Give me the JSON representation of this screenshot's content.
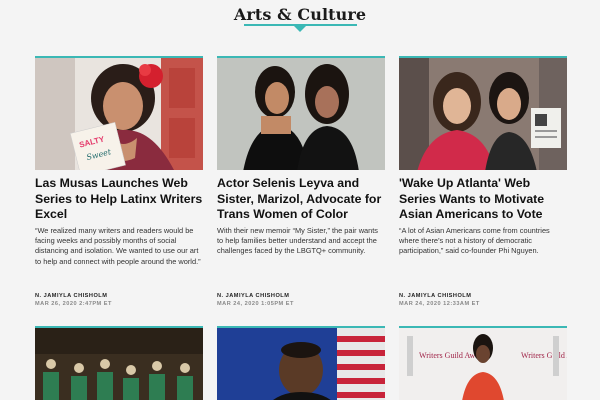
{
  "section": {
    "title": "Arts & Culture",
    "accent": "#3bb8b5"
  },
  "articles": [
    {
      "headline": "Las Musas Launches Web Series to Help Latinx Writers Excel",
      "excerpt": "“We realized many writers and readers would be facing weeks and possibly months of social distancing and isolation. We wanted to use our art to help and connect with people around the world.”",
      "author": "N. JAMIYLA CHISHOLM",
      "date": "MAR 26, 2020 2:47PM ET",
      "book_text_1": "SALTY",
      "book_text_2": "Sweet"
    },
    {
      "headline": "Actor Selenis Leyva and Sister, Marizol, Advocate for Trans Women of Color",
      "excerpt": "With their new memoir “My Sister,” the pair wants to help families better understand and accept the challenges faced by the LBGTQ+ community.",
      "author": "N. JAMIYLA CHISHOLM",
      "date": "MAR 24, 2020 1:05PM ET"
    },
    {
      "headline": "'Wake Up Atlanta' Web Series Wants to Motivate Asian Americans to Vote",
      "excerpt": "“A lot of Asian Americans come from countries where there’s not a history of democratic participation,” said co-founder Phi Nguyen.",
      "author": "N. JAMIYLA CHISHOLM",
      "date": "MAR 24, 2020 12:33AM ET"
    }
  ],
  "bottom_thumbs": [
    {
      "alt_text_1": "",
      "alt_text_2": ""
    },
    {
      "alt_text_1": "",
      "alt_text_2": ""
    },
    {
      "alt_text_1": "Writers Guild Awards",
      "alt_text_2": "Writers Guild Awards"
    }
  ]
}
